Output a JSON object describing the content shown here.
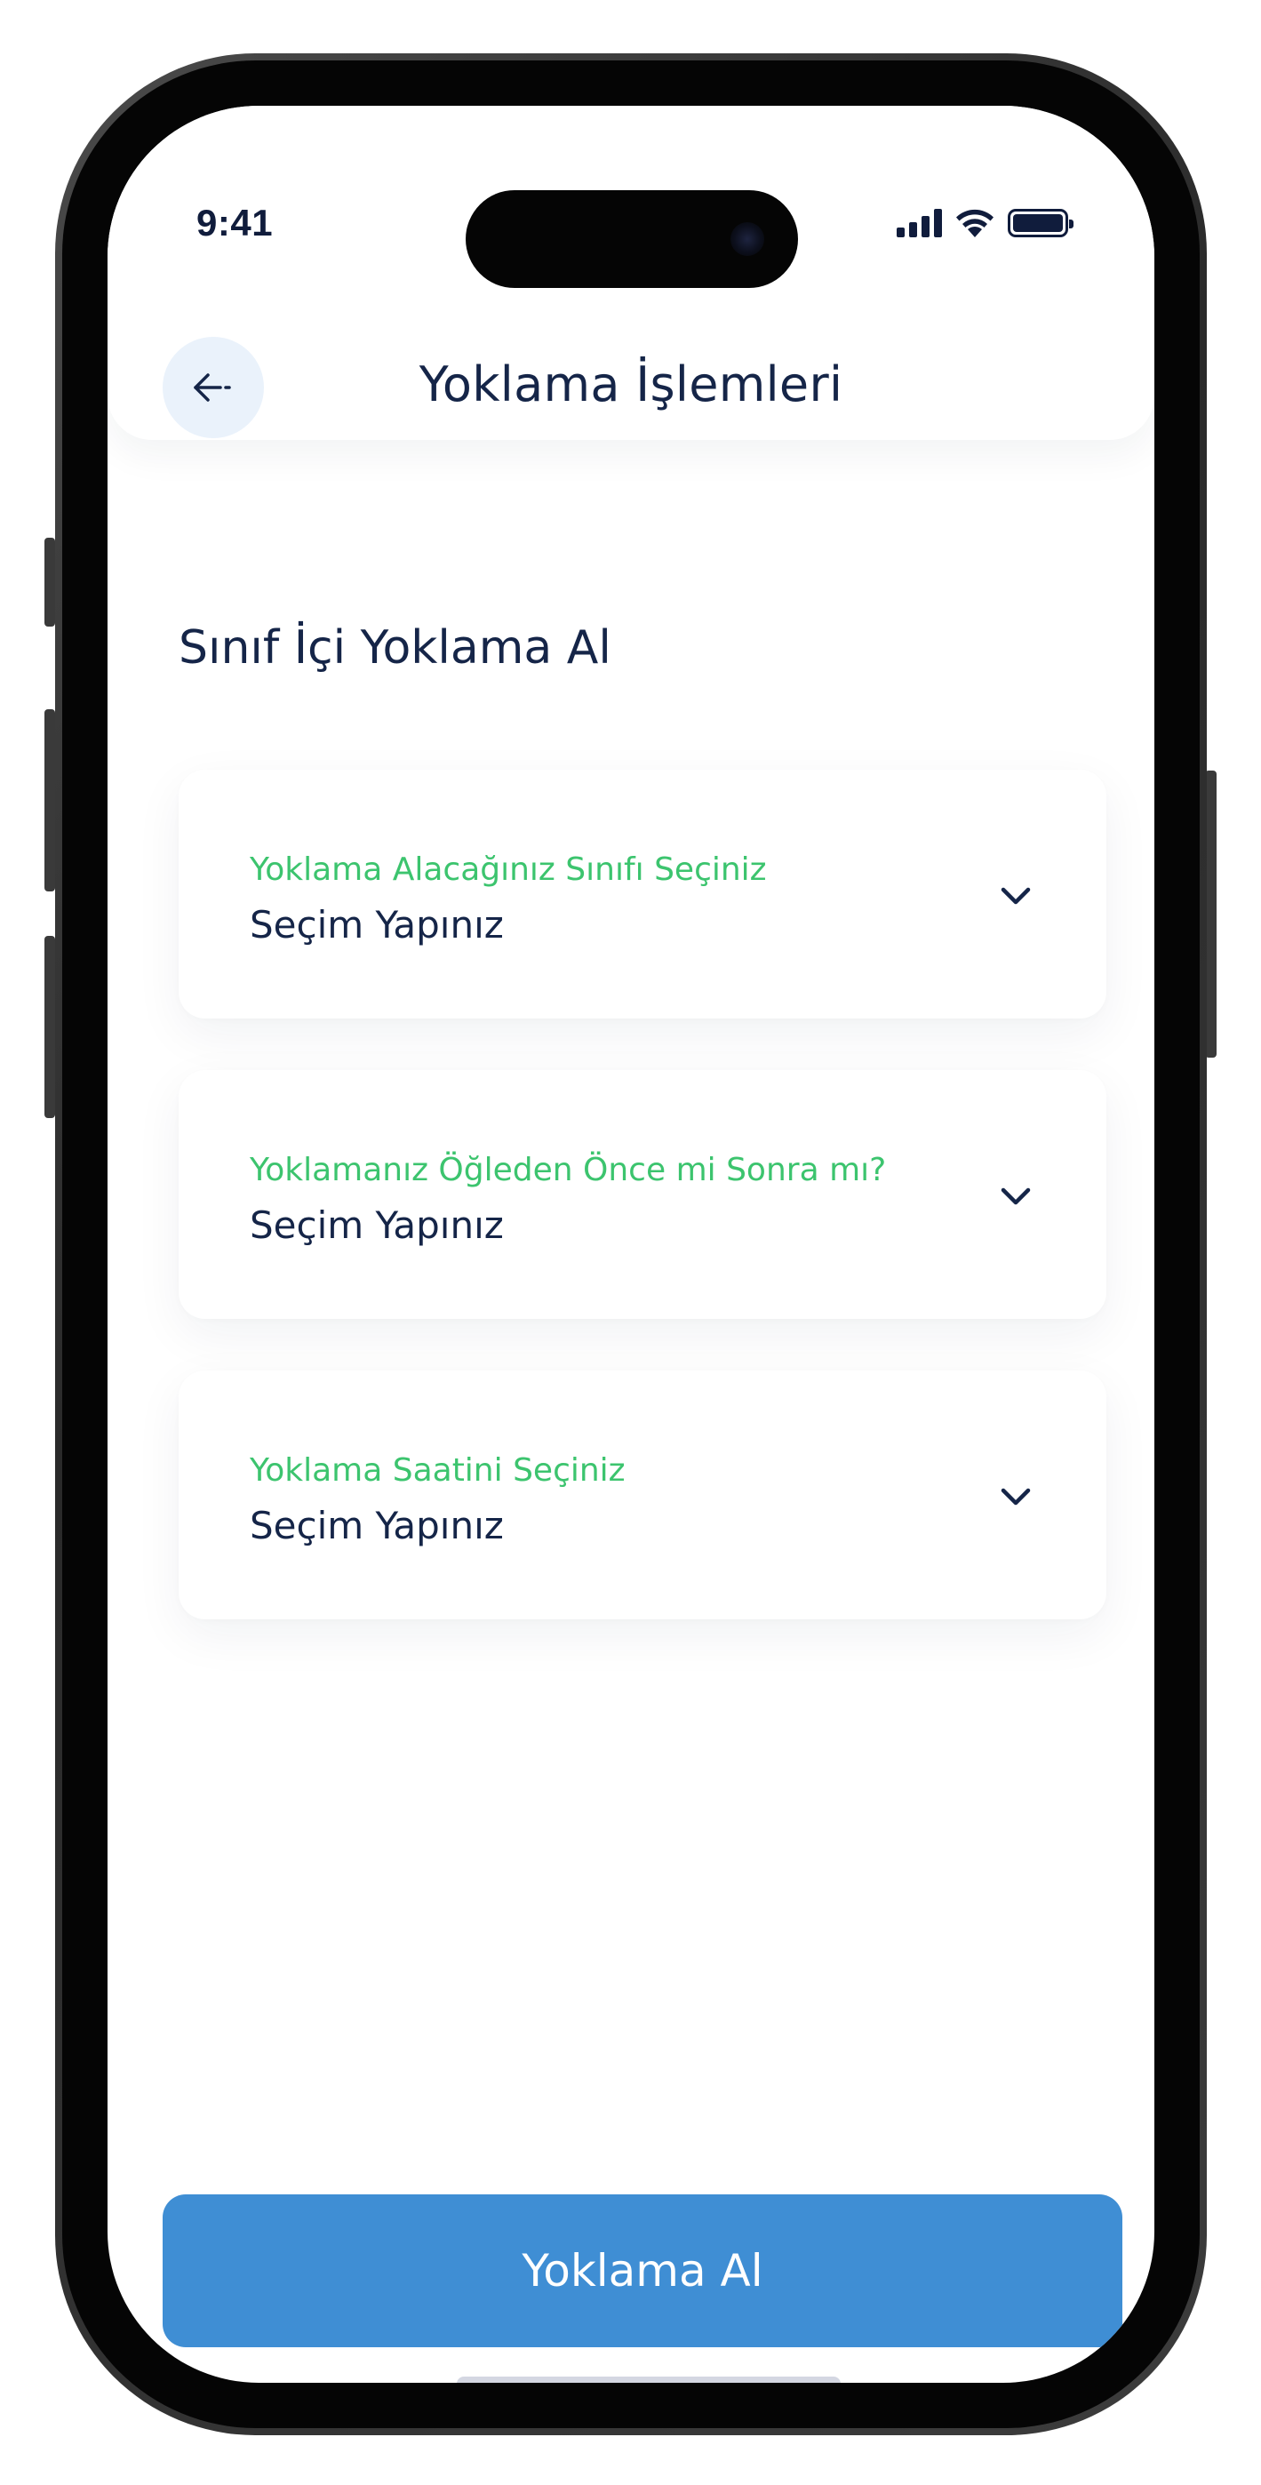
{
  "status_bar": {
    "time": "9:41",
    "icons": [
      "cellular-signal-icon",
      "wifi-icon",
      "battery-icon"
    ]
  },
  "header": {
    "title": "Yoklama İşlemleri",
    "back_icon": "arrow-left-icon"
  },
  "section": {
    "title": "Sınıf İçi Yoklama Al"
  },
  "selects": [
    {
      "label": "Yoklama Alacağınız Sınıfı Seçiniz",
      "value": "Seçim Yapınız",
      "icon": "chevron-down-icon"
    },
    {
      "label": "Yoklamanız Öğleden Önce mi Sonra mı?",
      "value": "Seçim Yapınız",
      "icon": "chevron-down-icon"
    },
    {
      "label": "Yoklama Saatini Seçiniz",
      "value": "Seçim Yapınız",
      "icon": "chevron-down-icon"
    }
  ],
  "primary_button": {
    "label": "Yoklama Al"
  },
  "colors": {
    "accent_green": "#3cc46e",
    "primary_blue": "#3f8ed4",
    "text_dark": "#152548",
    "back_button_bg": "#eaf2fb"
  }
}
